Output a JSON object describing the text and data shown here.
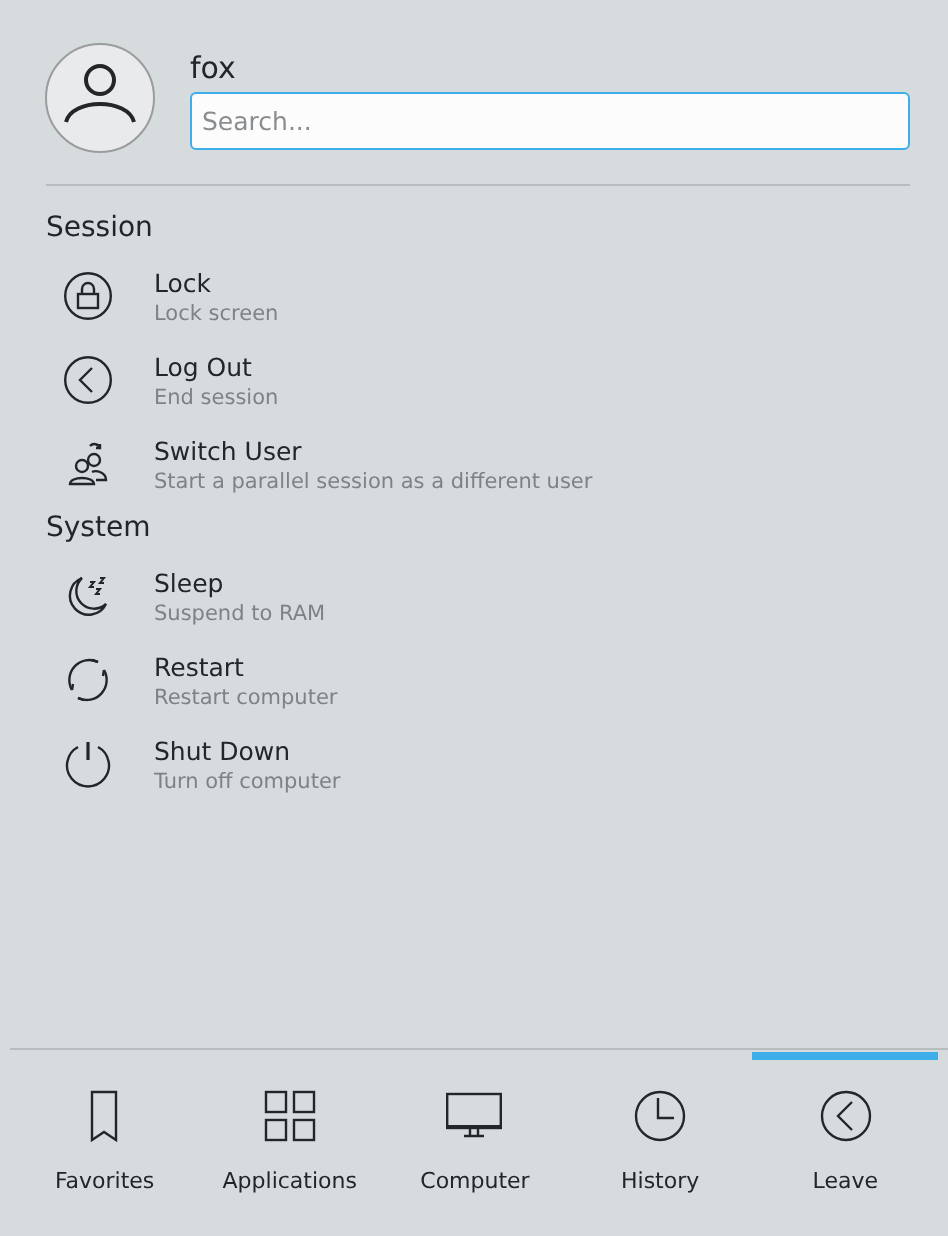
{
  "user": {
    "name": "fox"
  },
  "search": {
    "placeholder": "Search..."
  },
  "sections": [
    {
      "title": "Session",
      "items": [
        {
          "kind": "lock",
          "title": "Lock",
          "subtitle": "Lock screen"
        },
        {
          "kind": "logout",
          "title": "Log Out",
          "subtitle": "End session"
        },
        {
          "kind": "switch-user",
          "title": "Switch User",
          "subtitle": "Start a parallel session as a different user"
        }
      ]
    },
    {
      "title": "System",
      "items": [
        {
          "kind": "sleep",
          "title": "Sleep",
          "subtitle": "Suspend to RAM"
        },
        {
          "kind": "restart",
          "title": "Restart",
          "subtitle": "Restart computer"
        },
        {
          "kind": "shutdown",
          "title": "Shut Down",
          "subtitle": "Turn off computer"
        }
      ]
    }
  ],
  "tabs": [
    {
      "kind": "favorites",
      "label": "Favorites",
      "selected": false
    },
    {
      "kind": "applications",
      "label": "Applications",
      "selected": false
    },
    {
      "kind": "computer",
      "label": "Computer",
      "selected": false
    },
    {
      "kind": "history",
      "label": "History",
      "selected": false
    },
    {
      "kind": "leave",
      "label": "Leave",
      "selected": true
    }
  ]
}
